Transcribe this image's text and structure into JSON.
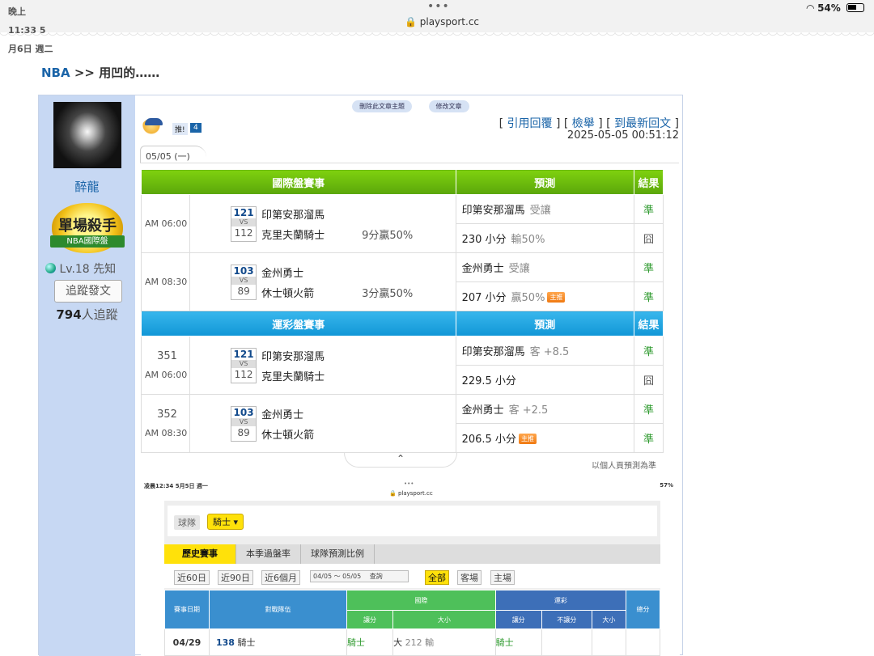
{
  "status_bar": {
    "time": "晚上11:33  5月6日 週二",
    "dots": "•••",
    "url": "🔒 playsport.cc",
    "right": "54%"
  },
  "breadcrumb": {
    "section": "NBA",
    "sep": ">>",
    "title": "用凹的……"
  },
  "user": {
    "name": "醉龍",
    "badge_title": "單場殺手",
    "badge_sub": "NBA國際盤",
    "level": "Lv.18 先知",
    "follow_button": "追蹤發文",
    "followers_count": "794",
    "followers_label": "人追蹤"
  },
  "post": {
    "top_buttons": [
      "刪除此文章主題",
      "修改文章"
    ],
    "push_label": "推!",
    "push_count": "4",
    "actions": {
      "quote": "引用回覆",
      "report": "檢舉",
      "latest": "到最新回文"
    },
    "date": "2025-05-05 00:51:12",
    "tab_date": "05/05 (一)"
  },
  "intl_section": {
    "header": {
      "match": "國際盤賽事",
      "predict": "預測",
      "result": "結果"
    },
    "games": [
      {
        "time": "AM 06:00",
        "code1": "121",
        "team1": "印第安那溜馬",
        "vs": "VS",
        "code2": "112",
        "team2": "克里夫蘭騎士",
        "margin": "9分贏50%",
        "picks": [
          {
            "main": "印第安那溜馬",
            "sub": "受讓",
            "hot": "",
            "result": "準"
          },
          {
            "main": "230 小分",
            "sub": "輸50%",
            "hot": "",
            "result": "囧"
          }
        ]
      },
      {
        "time": "AM 08:30",
        "code1": "103",
        "team1": "金州勇士",
        "vs": "VS",
        "code2": "89",
        "team2": "休士頓火箭",
        "margin": "3分贏50%",
        "picks": [
          {
            "main": "金州勇士",
            "sub": "受讓",
            "hot": "",
            "result": "準"
          },
          {
            "main": "207 小分",
            "sub": "贏50%",
            "hot": "主推",
            "result": "準"
          }
        ]
      }
    ]
  },
  "lottery_section": {
    "header": {
      "match": "運彩盤賽事",
      "predict": "預測",
      "result": "結果"
    },
    "games": [
      {
        "num": "351",
        "time": "AM 06:00",
        "code1": "121",
        "team1": "印第安那溜馬",
        "vs": "VS",
        "code2": "112",
        "team2": "克里夫蘭騎士",
        "picks": [
          {
            "main": "印第安那溜馬",
            "sub": "客 +8.5",
            "hot": "",
            "result": "準"
          },
          {
            "main": "229.5 小分",
            "sub": "",
            "hot": "",
            "result": "囧"
          }
        ]
      },
      {
        "num": "352",
        "time": "AM 08:30",
        "code1": "103",
        "team1": "金州勇士",
        "vs": "VS",
        "code2": "89",
        "team2": "休士頓火箭",
        "picks": [
          {
            "main": "金州勇士",
            "sub": "客 +2.5",
            "hot": "",
            "result": "準"
          },
          {
            "main": "206.5 小分",
            "sub": "",
            "hot": "主推",
            "result": "準"
          }
        ]
      }
    ]
  },
  "collapse_arrow": "⌃",
  "note": "以個人頁預測為準",
  "embedded": {
    "status_time": "凌晨12:34  5月5日 週一",
    "dots": "•••",
    "url": "🔒 playsport.cc",
    "right": "57%",
    "team_label": "球隊",
    "team_selected": "騎士 ▾",
    "tabs": [
      "歷史賽事",
      "本季過盤率",
      "球隊預測比例"
    ],
    "filters": {
      "d60": "近60日",
      "d90": "近90日",
      "m6": "近6個月",
      "range": "04/05  ～  05/05",
      "query": "查詢",
      "all": "全部",
      "away": "客場",
      "home": "主場"
    },
    "header": {
      "date": "賽事日期",
      "teams": "對戰隊伍",
      "intl": "國際",
      "lottery": "運彩",
      "total": "總分",
      "spread": "讓分",
      "ou": "大小",
      "spread2": "讓分",
      "nospread": "不讓分",
      "ou2": "大小"
    },
    "row": {
      "date": "04/29",
      "code": "138",
      "team": "騎士",
      "intl_spread": "騎士",
      "intl_ou": "大",
      "intl_ou_num": "212",
      "intl_ou_res": "輸",
      "lot_spread": "騎士"
    }
  }
}
